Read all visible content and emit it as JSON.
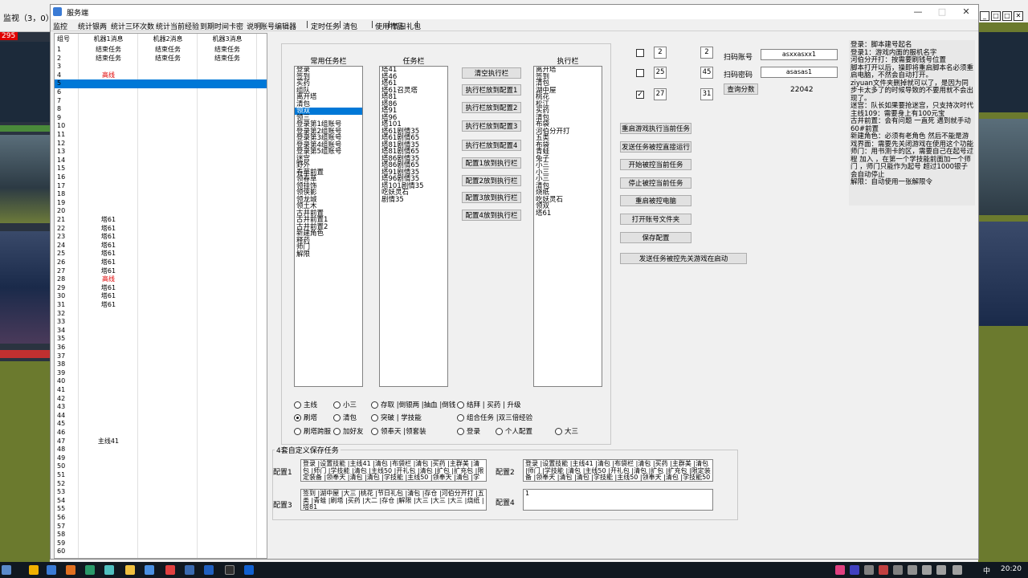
{
  "outer_window": {
    "title": "监视（3，0）",
    "counter": "295"
  },
  "window": {
    "title": "服务端"
  },
  "menu": [
    "监控",
    "统计银两",
    "统计三环次数",
    "统计当前经验",
    "到期时间卡密",
    "说明",
    "账号编辑器",
    "定时任务",
    "清包",
    "使用物品",
    "节日礼包"
  ],
  "grid": {
    "headers": [
      "组号",
      "机器1消息",
      "机器2消息",
      "机器3消息"
    ],
    "selected_row": 5,
    "rows": [
      [
        "1",
        "结束任务",
        "结束任务",
        "结束任务"
      ],
      [
        "2",
        "结束任务",
        "结束任务",
        "结束任务"
      ],
      [
        "3",
        "",
        "",
        ""
      ],
      [
        "4",
        "高线",
        "",
        ""
      ],
      [
        "5",
        "",
        "",
        ""
      ],
      [
        "6",
        "",
        "",
        ""
      ],
      [
        "7",
        "",
        "",
        ""
      ],
      [
        "8",
        "",
        "",
        ""
      ],
      [
        "9",
        "",
        "",
        ""
      ],
      [
        "10",
        "",
        "",
        ""
      ],
      [
        "11",
        "",
        "",
        ""
      ],
      [
        "12",
        "",
        "",
        ""
      ],
      [
        "13",
        "",
        "",
        ""
      ],
      [
        "14",
        "",
        "",
        ""
      ],
      [
        "15",
        "",
        "",
        ""
      ],
      [
        "16",
        "",
        "",
        ""
      ],
      [
        "17",
        "",
        "",
        ""
      ],
      [
        "18",
        "",
        "",
        ""
      ],
      [
        "19",
        "",
        "",
        ""
      ],
      [
        "20",
        "",
        "",
        ""
      ],
      [
        "21",
        "塔61",
        "",
        ""
      ],
      [
        "22",
        "塔61",
        "",
        ""
      ],
      [
        "23",
        "塔61",
        "",
        ""
      ],
      [
        "24",
        "塔61",
        "",
        ""
      ],
      [
        "25",
        "塔61",
        "",
        ""
      ],
      [
        "26",
        "塔61",
        "",
        ""
      ],
      [
        "27",
        "塔61",
        "",
        ""
      ],
      [
        "28",
        "高线",
        "",
        ""
      ],
      [
        "29",
        "塔61",
        "",
        ""
      ],
      [
        "30",
        "塔61",
        "",
        ""
      ],
      [
        "31",
        "塔61",
        "",
        ""
      ],
      [
        "32",
        "",
        "",
        ""
      ],
      [
        "33",
        "",
        "",
        ""
      ],
      [
        "34",
        "",
        "",
        ""
      ],
      [
        "35",
        "",
        "",
        ""
      ],
      [
        "36",
        "",
        "",
        ""
      ],
      [
        "37",
        "",
        "",
        ""
      ],
      [
        "38",
        "",
        "",
        ""
      ],
      [
        "39",
        "",
        "",
        ""
      ],
      [
        "40",
        "",
        "",
        ""
      ],
      [
        "41",
        "",
        "",
        ""
      ],
      [
        "42",
        "",
        "",
        ""
      ],
      [
        "43",
        "",
        "",
        ""
      ],
      [
        "44",
        "",
        "",
        ""
      ],
      [
        "45",
        "",
        "",
        ""
      ],
      [
        "46",
        "",
        "",
        ""
      ],
      [
        "47",
        "主线41",
        "",
        ""
      ],
      [
        "48",
        "",
        "",
        ""
      ],
      [
        "49",
        "",
        "",
        ""
      ],
      [
        "50",
        "",
        "",
        ""
      ],
      [
        "51",
        "",
        "",
        ""
      ],
      [
        "52",
        "",
        "",
        ""
      ],
      [
        "53",
        "",
        "",
        ""
      ],
      [
        "54",
        "",
        "",
        ""
      ],
      [
        "55",
        "",
        "",
        ""
      ],
      [
        "56",
        "",
        "",
        ""
      ],
      [
        "57",
        "",
        "",
        ""
      ],
      [
        "58",
        "",
        "",
        ""
      ],
      [
        "59",
        "",
        "",
        ""
      ],
      [
        "60",
        "",
        "",
        ""
      ]
    ],
    "red_values": [
      "高线"
    ]
  },
  "common_tasks": {
    "label": "常用任务栏",
    "selected": "领双",
    "items": [
      "登录",
      "签到",
      "买药",
      "组队",
      "离开塔",
      "清包",
      "领双",
      "领三",
      "登录第1组账号",
      "登录第2组账号",
      "登录第3组账号",
      "登录第4组账号",
      "登录第5组账号",
      "迷宫",
      "野外",
      "春華前置",
      "领春草",
      "领挂饰",
      "领侠影",
      "领龙城",
      "领土木",
      "古井前置",
      "古井前置1",
      "古井前置2",
      "新建角色",
      "释药",
      "师门",
      "解限"
    ]
  },
  "task_list": {
    "label": "任务栏",
    "items": [
      "塔41",
      "塔46",
      "塔61",
      "塔61召灵塔",
      "塔81",
      "塔86",
      "塔91",
      "塔96",
      "塔101",
      "塔61剧情35",
      "塔61剧情65",
      "塔81剧情35",
      "塔81剧情65",
      "塔86剧情35",
      "塔86剧情65",
      "塔91剧情35",
      "塔96剧情35",
      "塔101剧情35",
      "吃妖灵石",
      "剧情35"
    ]
  },
  "exec_list": {
    "label": "执行栏",
    "items": [
      "离开塔",
      "签到",
      "清包",
      "湖中屋",
      "桃花",
      "松江",
      "买药",
      "清包",
      "布袋",
      "河伯分开打",
      "五类",
      "布袋",
      "青蛙",
      "兔子",
      "小三",
      "小三",
      "小三",
      "清包",
      "烧纸",
      "吃妖灵石",
      "领双",
      "塔61"
    ]
  },
  "mid_buttons": [
    "清空执行栏",
    "执行栏放到配置1",
    "执行栏放到配置2",
    "执行栏放到配置3",
    "执行栏放到配置4",
    "配置1放到执行栏",
    "配置2放到执行栏",
    "配置3放到执行栏",
    "配置4放到执行栏"
  ],
  "radios": [
    {
      "label": "主线",
      "on": false
    },
    {
      "label": "小三",
      "on": false
    },
    {
      "label": "存取 |倒银两 |抽血 |倒钱",
      "on": false
    },
    {
      "label": "结拜 | 买药 | 升级",
      "on": false
    },
    {
      "label": "刷塔",
      "on": true
    },
    {
      "label": "清包",
      "on": false
    },
    {
      "label": "突破 | 学技能",
      "on": false
    },
    {
      "label": "组合任务 |双三倍经验",
      "on": false
    },
    {
      "label": "刷塔跨服",
      "on": false
    },
    {
      "label": "加好友",
      "on": false
    },
    {
      "label": "领奉天 |领套装",
      "on": false
    },
    {
      "label": "登录",
      "on": false
    },
    {
      "label": "个人配置",
      "on": false
    },
    {
      "label": "大三",
      "on": false
    }
  ],
  "group": {
    "title": "4套自定义保存任务",
    "cfg1_label": "配置1",
    "cfg2_label": "配置2",
    "cfg3_label": "配置3",
    "cfg4_label": "配置4",
    "cfg1": "登录 |设置技能 |主线41 |清包 |布袋栏 |清包 |买药 |主群美 |清包 |师门 |学技能 |清包 |主线50 |开礼包 |清包 |扩包 |扩充包 |限定装备 |领奉天 |清包 |清包 |学技能 |主线50 |领奉天 |清包 |学技能50 |加好友 |加",
    "cfg2": "登录 |设置技能 |主线41 |清包 |布袋栏 |清包 |买药 |主群美 |清包 |师门 |学技能 |清包 |主线50 |开礼包 |清包 |扩包 |扩充包 |限定装备 |领奉天 |清包 |清包 |学技能 |主线50 |领奉天 |清包 |学技能50 |加好友 |加",
    "cfg3": "签到 |湖中屋 |大三 |桃花 |节日礼包 |清包 |存仓 |河伯分开打 |五类 |青蛙 |刷塔 |买药 |大二 |存仓 |解限 |大三 |大三 |大三 |烧纸 |塔81",
    "cfg4": "1"
  },
  "right": {
    "rows": [
      {
        "checked": false,
        "a": "2",
        "b": "2"
      },
      {
        "checked": false,
        "a": "25",
        "b": "45"
      },
      {
        "checked": true,
        "a": "27",
        "b": "31"
      }
    ],
    "scan_account_label": "扫码账号",
    "scan_account_value": "asxxasxx1",
    "scan_pwd_label": "扫码密码",
    "scan_pwd_value": "asasas1",
    "query_button": "查询分数",
    "score": "22042"
  },
  "action_buttons": [
    "重启游戏执行当前任务",
    "发送任务被控直接运行",
    "开始被控当前任务",
    "停止被控当前任务",
    "重启被控电脑",
    "打开账号文件夹",
    "保存配置",
    "发送任务被控先关游戏在启动"
  ],
  "notes": "登录：脚本建号起名\n登录1：游戏内面的服机名字\n河伯分开打：按需要刷钱号位置\n脚本打开以后，操即将重启脚本名必须重启电脑，不然会自动打开。\nziyuan文件夹删掉就可以了，是因为同步卡太多了的时候导致的不要用就不会出现了。\n迷宫：队长如果要抢迷宫，只支持次时代主线109：需要身上有100元宝\n古井前置：会有问题 一直死 遇到就手动60#前置\n新建角色：必须有老角色 然后不能是游戏界面：需要先关闭游戏在使用这个功能\n师门：用书测卡的区，需要自己在起号过程 加入 ，在第一个学技能前面加一个师门 ，师门只能作为起号 超过1000银子会自动停止\n解限：自动使用一张解限令",
  "taskbar": {
    "ime": "中",
    "clock": "20:20"
  }
}
